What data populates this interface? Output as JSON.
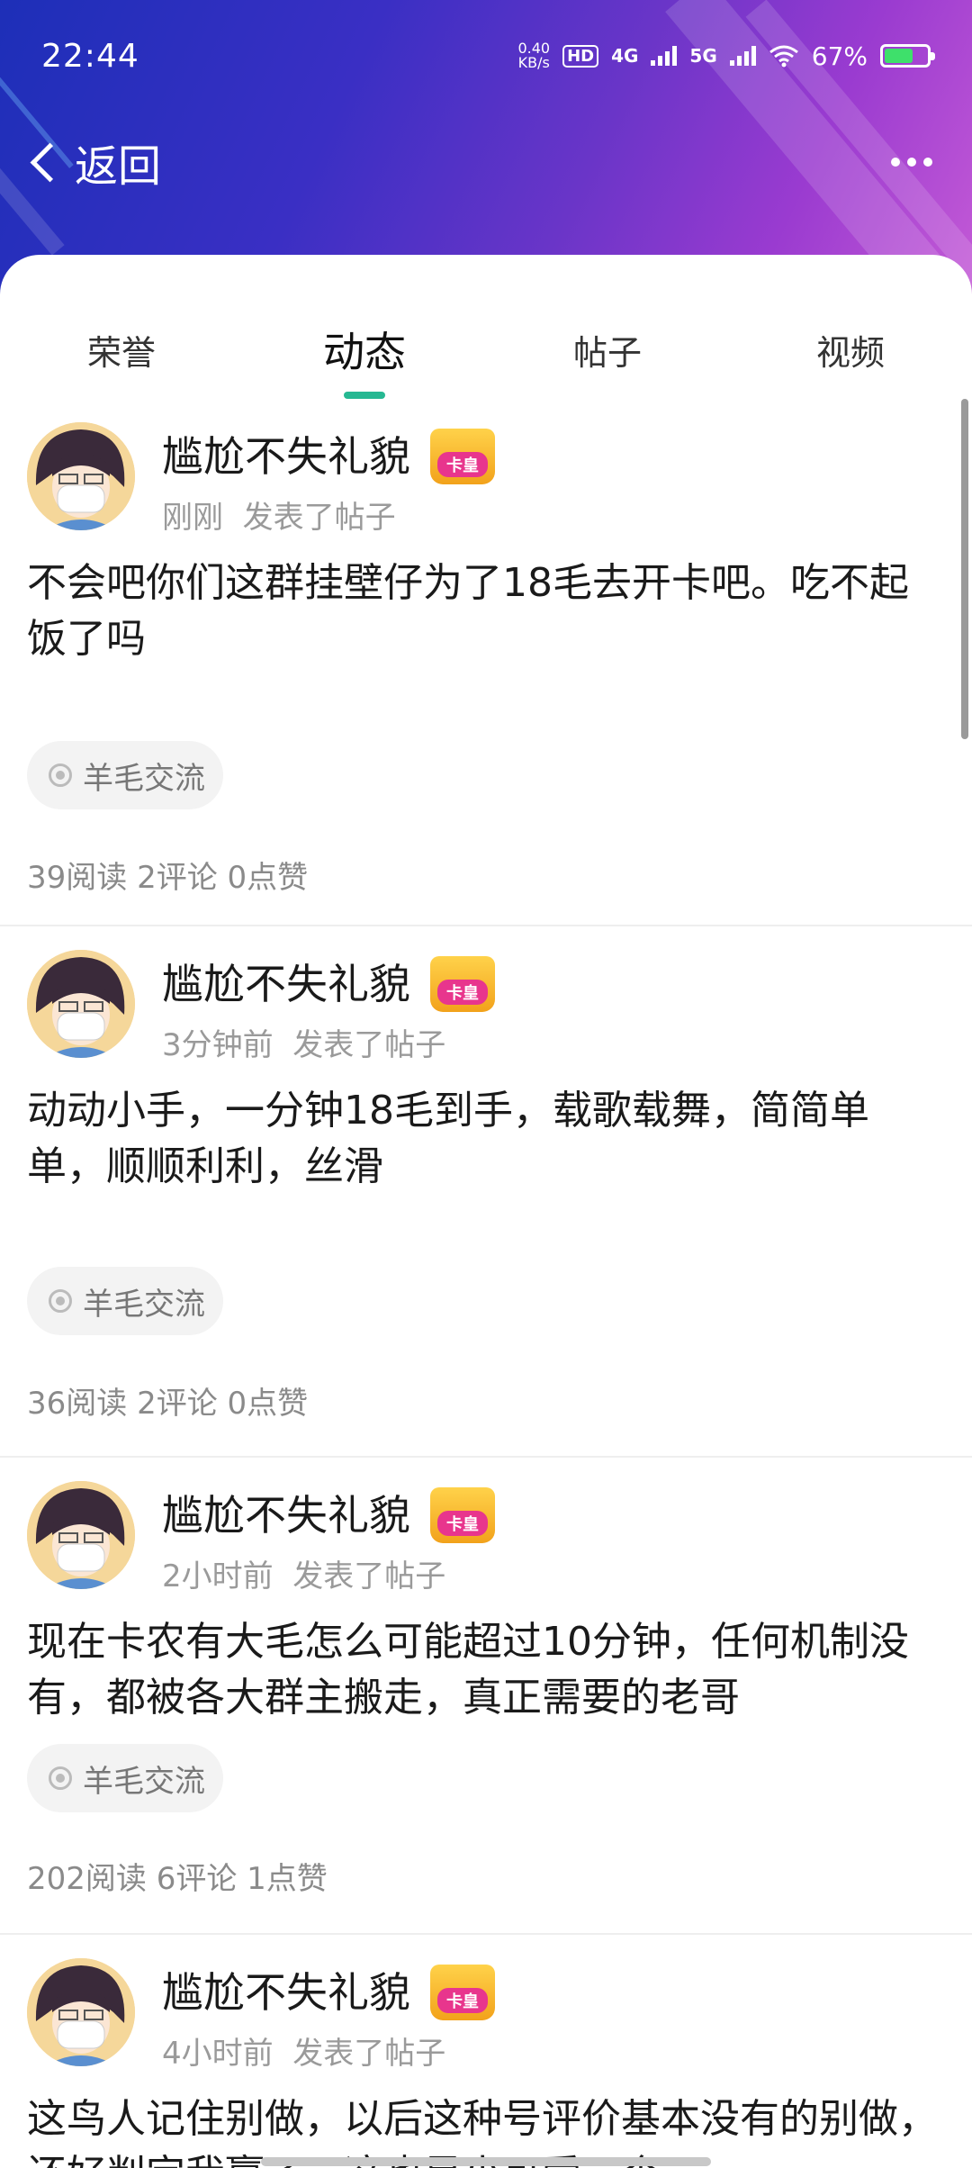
{
  "status_bar": {
    "time": "22:44",
    "speed": "0.40",
    "speed_unit": "KB/s",
    "hd": "HD",
    "net1": "4G",
    "net2": "5G",
    "battery": "67%"
  },
  "nav": {
    "back_label": "返回"
  },
  "tabs": [
    {
      "label": "荣誉"
    },
    {
      "label": "动态",
      "active": true
    },
    {
      "label": "帖子"
    },
    {
      "label": "视频"
    }
  ],
  "badge_label": "卡皇",
  "posts": [
    {
      "author": "尴尬不失礼貌",
      "time": "刚刚",
      "action": "发表了帖子",
      "content": "不会吧你们这群挂壁仔为了18毛去开卡吧。吃不起饭了吗",
      "tag": "羊毛交流",
      "stats": "39阅读 2评论 0点赞"
    },
    {
      "author": "尴尬不失礼貌",
      "time": "3分钟前",
      "action": "发表了帖子",
      "content": "动动小手，一分钟18毛到手，载歌载舞，简简单单，顺顺利利，丝滑",
      "tag": "羊毛交流",
      "stats": "36阅读 2评论 0点赞"
    },
    {
      "author": "尴尬不失礼貌",
      "time": "2小时前",
      "action": "发表了帖子",
      "content": "现在卡农有大毛怎么可能超过10分钟，任何机制没有，都被各大群主搬走，真正需要的老哥",
      "tag": "羊毛交流",
      "stats": "202阅读 6评论 1点赞"
    },
    {
      "author": "尴尬不失礼貌",
      "time": "4小时前",
      "action": "发表了帖子",
      "content": "这鸟人记住别做，以后这种号评价基本没有的别做，还好判定我赢了，这也是小可爱一个",
      "tag": "",
      "stats": ""
    }
  ]
}
